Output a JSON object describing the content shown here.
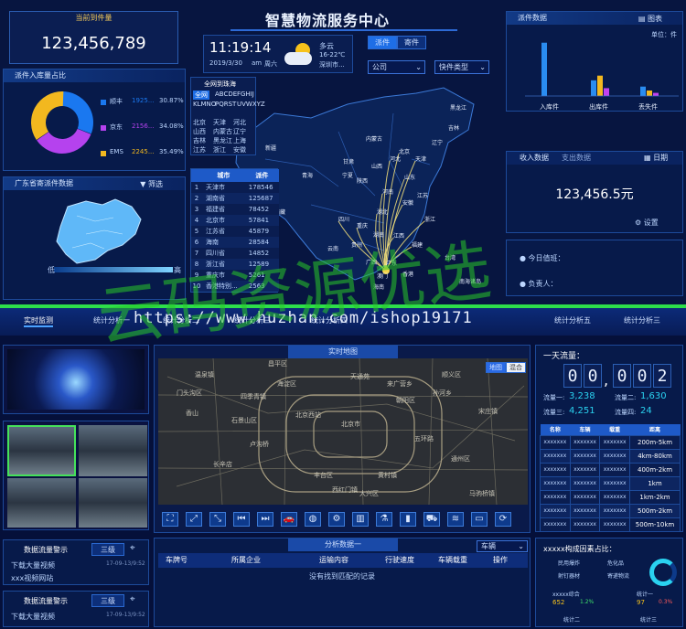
{
  "top": {
    "title": "智慧物流服务中心",
    "total": {
      "label": "当前到件量",
      "value": "123,456,789"
    },
    "ratio": {
      "title": "派件入库量占比",
      "items": [
        {
          "name": "顺丰",
          "value": "1925...",
          "pct": "30.87%",
          "share": 30.87,
          "color": "#1a78f0"
        },
        {
          "name": "京东",
          "value": "2156...",
          "pct": "34.08%",
          "share": 34.08,
          "color": "#b542ee"
        },
        {
          "name": "EMS",
          "value": "2245...",
          "pct": "35.49%",
          "share": 35.05,
          "color": "#f2b81f"
        }
      ]
    },
    "gd": {
      "title": "广东省寄派件数据",
      "filter": "筛选",
      "low": "低",
      "high": "高"
    },
    "clock": {
      "time": "11:19:14",
      "date": "2019/3/30",
      "ampm": "am",
      "weekday": "周六",
      "weather": "多云",
      "temp": "16-22℃",
      "city": "深圳市..."
    },
    "tabs": [
      "派件",
      "寄件"
    ],
    "company_select": "公司",
    "express_select": "快件类型",
    "map": {
      "city_title": "全网到珠海",
      "letters": [
        "全网",
        "ABCDE",
        "FGHIJ",
        "KLMNO",
        "PQRST",
        "UVWXYZ"
      ],
      "region_rows": [
        [
          "北京",
          "天津",
          "河北"
        ],
        [
          "山西",
          "内蒙古",
          "辽宁"
        ],
        [
          "吉林",
          "黑龙江",
          "上海"
        ],
        [
          "江苏",
          "浙江",
          "安徽"
        ]
      ],
      "province_labels": [
        "新疆",
        "西藏",
        "青海",
        "甘肃",
        "四川",
        "重庆",
        "云南",
        "贵州",
        "湖南",
        "湖北",
        "广西",
        "广东",
        "海南",
        "福建",
        "江西",
        "浙江",
        "江苏",
        "安徽",
        "河南",
        "山东",
        "河北",
        "北京",
        "天津",
        "山西",
        "陕西",
        "宁夏",
        "内蒙古",
        "辽宁",
        "吉林",
        "黑龙江",
        "台湾",
        "香港",
        "澳门",
        "南海诸岛"
      ],
      "table_headers": [
        "城市",
        "派件"
      ],
      "table_rows": [
        [
          "1",
          "天津市",
          "178546"
        ],
        [
          "2",
          "湖南省",
          "125687"
        ],
        [
          "3",
          "福建省",
          "78452"
        ],
        [
          "4",
          "北京市",
          "57841"
        ],
        [
          "5",
          "江苏省",
          "45879"
        ],
        [
          "6",
          "海南",
          "28584"
        ],
        [
          "7",
          "四川省",
          "14852"
        ],
        [
          "8",
          "浙江省",
          "12589"
        ],
        [
          "9",
          "重庆市",
          "5261"
        ],
        [
          "10",
          "香港特别...",
          "2563"
        ]
      ]
    },
    "dispatch": {
      "title": "派件数据",
      "chart_btn": "图表",
      "unit": "单位：件",
      "chart_data": {
        "type": "bar",
        "categories": [
          "入库件",
          "出库件",
          "丢失件"
        ],
        "series": [
          {
            "values": [
              68,
              20,
              12
            ],
            "color": "#2a8cf0"
          },
          {
            "values": [
              0,
              26,
              7
            ],
            "color": "#f2b81f"
          },
          {
            "values": [
              0,
              10,
              4
            ],
            "color": "#c242ee"
          }
        ],
        "ylim": [
          0,
          70
        ]
      }
    },
    "income": {
      "title": "收入数据",
      "tab2": "支出数据",
      "date_btn": "日期",
      "value": "123,456.5元",
      "settings": "设置"
    },
    "duty": {
      "title": "今日值班：",
      "owner": "负责人："
    }
  },
  "nav": {
    "items": [
      "实时监测",
      "统计分析一",
      "统计分析二",
      "统计分析三",
      "统计分析四",
      "统计分析五",
      "统计分析三"
    ]
  },
  "bottom": {
    "map_title": "实时地图",
    "map_modes": [
      "地图",
      "混合"
    ],
    "map_labels": [
      "北京西站",
      "北京市",
      "通州区",
      "丰台区",
      "门头沟区",
      "海淀区",
      "朝阳区",
      "大兴区",
      "石景山区",
      "昌平区",
      "顺义区",
      "长辛店",
      "四季青镇",
      "马驹桥镇",
      "宋庄镇",
      "西红门镇",
      "黄村镇",
      "来广营乡",
      "孙河乡",
      "天通苑",
      "温泉镇",
      "香山",
      "卢沟桥",
      "五环路"
    ],
    "toolbar_icons": [
      "fullscreen-icon",
      "expand-icon",
      "collapse-icon",
      "prev-icon",
      "next-icon",
      "car-icon",
      "globe-icon",
      "gear-icon",
      "building-icon",
      "flask-icon",
      "chart-icon",
      "truck-icon",
      "signal-icon",
      "window-icon",
      "refresh-icon"
    ],
    "analysis": {
      "title": "分析数据一",
      "dropdown": "车辆",
      "headers": [
        "车牌号",
        "所属企业",
        "运输内容",
        "行驶速度",
        "车辆载重",
        "操作"
      ],
      "empty": "没有找到匹配的记录"
    },
    "left_cards": [
      {
        "title": "数据流量警示",
        "level": "三级",
        "line1": "下载大量视频",
        "time": "17-09-13/9:52",
        "line2": "xxx视频网站"
      },
      {
        "title": "数据流量警示",
        "level": "三级",
        "line1": "下载大量视频",
        "time": "17-09-13/9:52"
      }
    ],
    "flow": {
      "title": "一天流量：",
      "digits": [
        "0",
        "0",
        ",",
        "0",
        "0",
        "2"
      ],
      "stats": [
        {
          "label": "流量一:",
          "value": "3,238"
        },
        {
          "label": "流量二:",
          "value": "1,630"
        },
        {
          "label": "流量三:",
          "value": "4,251"
        },
        {
          "label": "流量四:",
          "value": "24"
        }
      ],
      "table_headers": [
        "名称",
        "车辆",
        "载重",
        "距离"
      ],
      "table_rows": [
        [
          "xxxxxxx",
          "xxxxxxx",
          "xxxxxxx",
          "200m-5km"
        ],
        [
          "xxxxxxx",
          "xxxxxxx",
          "xxxxxxx",
          "4km-80km"
        ],
        [
          "xxxxxxx",
          "xxxxxxx",
          "xxxxxxx",
          "400m-2km"
        ],
        [
          "xxxxxxx",
          "xxxxxxx",
          "xxxxxxx",
          "1km"
        ],
        [
          "xxxxxxx",
          "xxxxxxx",
          "xxxxxxx",
          "1km-2km"
        ],
        [
          "xxxxxxx",
          "xxxxxxx",
          "xxxxxxx",
          "500m-2km"
        ],
        [
          "xxxxxxx",
          "xxxxxxx",
          "xxxxxxx",
          "500m-10km"
        ]
      ]
    },
    "factors": {
      "title": "xxxxx构成因素占比：",
      "items": [
        "民用爆炸",
        "危化品",
        "射钉器材",
        "寄递物流"
      ],
      "stat1": {
        "label": "xxxxx综合",
        "value": "652",
        "change": "1.2%"
      },
      "stat2": {
        "label": "统计一",
        "value": "97",
        "change": "0.3%"
      },
      "stat3": "统计二",
      "stat4": "统计三"
    }
  },
  "watermark": {
    "text": "云码资源优选",
    "url": "https://www.huzhan.com/ishop19171"
  }
}
